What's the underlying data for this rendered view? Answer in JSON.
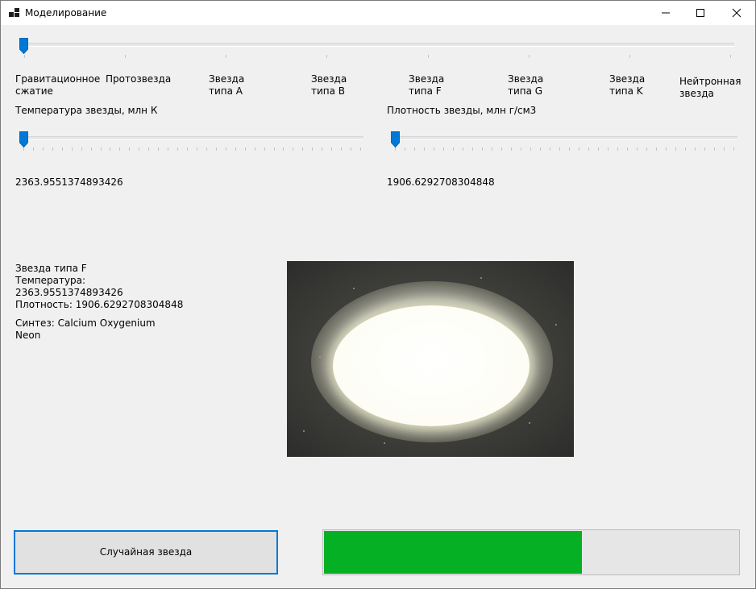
{
  "window": {
    "title": "Моделирование"
  },
  "stage_slider": {
    "labels": [
      "Гравитационное\nсжатие",
      "Протозвезда",
      "Звезда\nтипа A",
      "Звезда\nтипа B",
      "Звезда\nтипа F",
      "Звезда\nтипа G",
      "Звезда\nтипа K",
      "Нейтронная\nзвезда"
    ],
    "selected_index": 0
  },
  "temperature": {
    "label": "Температура звезды, млн К",
    "value": "2363.9551374893426",
    "slider_fraction": 0.0
  },
  "density": {
    "label": "Плотность звезды, млн г/см3",
    "value": "1906.6292708304848",
    "slider_fraction": 0.0
  },
  "info": {
    "star_type": "Звезда типа F",
    "temperature_label": "Температура:",
    "temperature_value": "2363.9551374893426",
    "density_line": "Плотность: 1906.6292708304848",
    "synthesis_line1": "Синтез: Calcium  Oxygenium",
    "synthesis_line2": "Neon"
  },
  "random_button": {
    "label": "Случайная звезда"
  },
  "progress": {
    "fraction": 0.62,
    "color": "#06b025"
  },
  "colors": {
    "accent": "#0078d7"
  }
}
